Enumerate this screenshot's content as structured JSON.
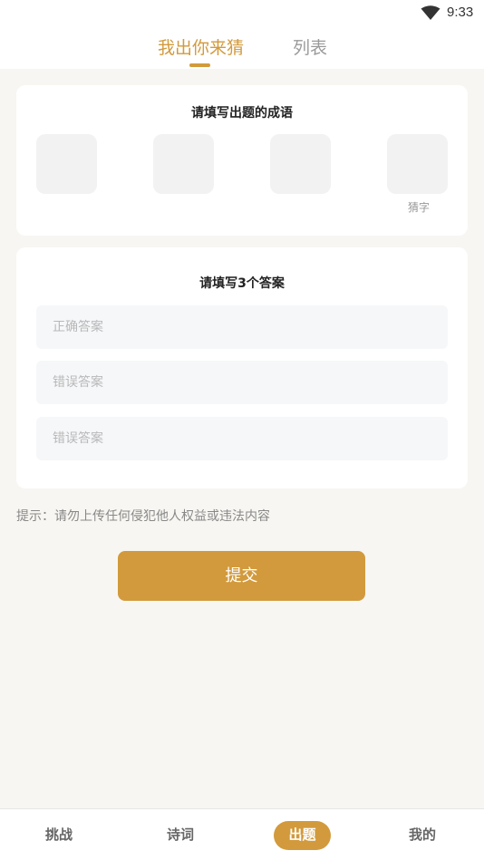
{
  "status_bar": {
    "time": "9:33",
    "wifi_icon": "wifi-icon"
  },
  "tabs": [
    {
      "label": "我出你来猜",
      "active": true
    },
    {
      "label": "列表",
      "active": false
    }
  ],
  "idiom_card": {
    "title": "请填写出题的成语",
    "guess_label": "猜字"
  },
  "answers_card": {
    "title": "请填写3个答案",
    "fields": [
      {
        "placeholder": "正确答案",
        "value": ""
      },
      {
        "placeholder": "错误答案",
        "value": ""
      },
      {
        "placeholder": "错误答案",
        "value": ""
      }
    ]
  },
  "hint": "提示：请勿上传任何侵犯他人权益或违法内容",
  "submit_label": "提交",
  "bottom_nav": [
    {
      "label": "挑战",
      "active": false
    },
    {
      "label": "诗词",
      "active": false
    },
    {
      "label": "出题",
      "active": true
    },
    {
      "label": "我的",
      "active": false
    }
  ],
  "colors": {
    "accent": "#d29a3c",
    "background": "#f7f6f2"
  }
}
